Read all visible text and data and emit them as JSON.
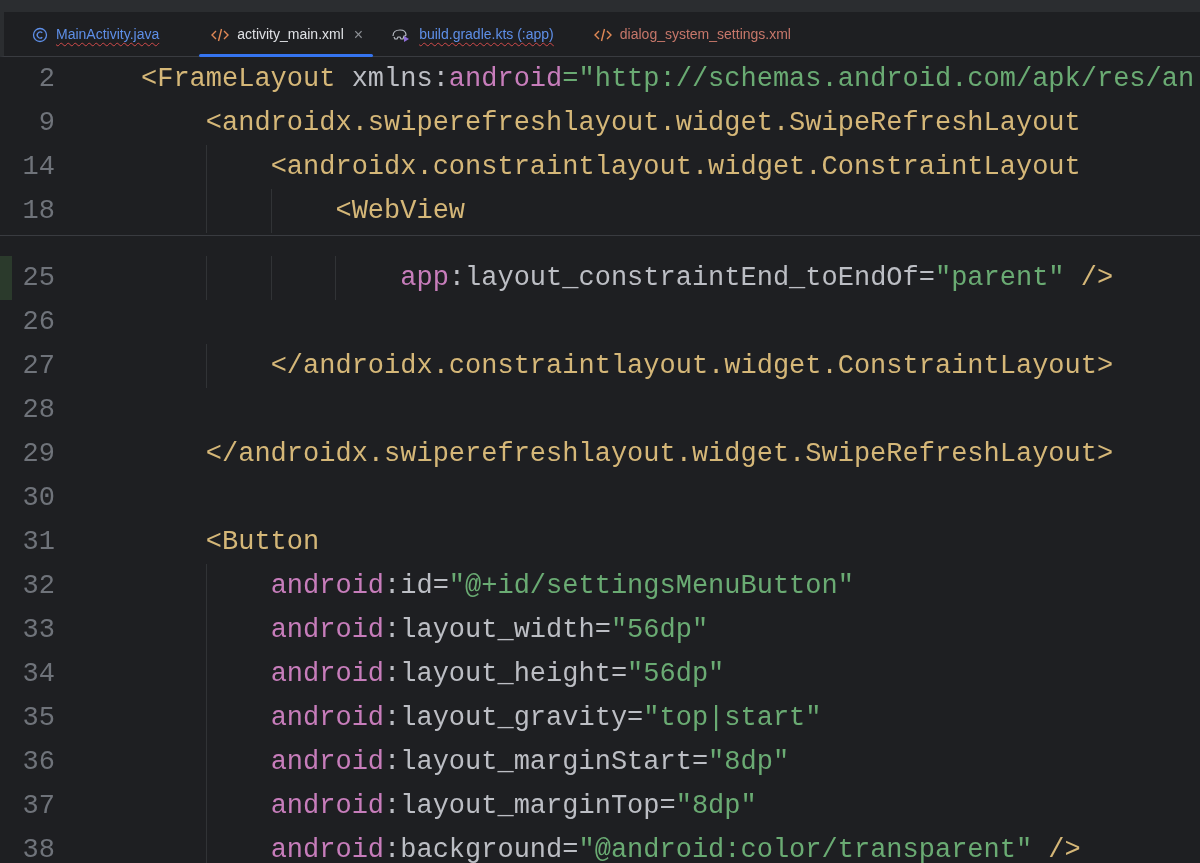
{
  "tabs": [
    {
      "label": "MainActivity.java",
      "kind": "class",
      "selected": false,
      "error": true,
      "color": "#5e8fe8"
    },
    {
      "label": "activity_main.xml",
      "kind": "xml",
      "selected": true,
      "error": false,
      "color": "#dfe1e5",
      "close": "×"
    },
    {
      "label": "build.gradle.kts (:app)",
      "kind": "gradle",
      "selected": false,
      "error": true,
      "color": "#5e8fe8"
    },
    {
      "label": "dialog_system_settings.xml",
      "kind": "xml",
      "selected": false,
      "error": false,
      "color": "#c7776a"
    }
  ],
  "sticky_lines": [
    {
      "number": "2",
      "tokens": [
        {
          "kind": "tag",
          "text": "<FrameLayout "
        },
        {
          "kind": "attr",
          "text": "xmlns:"
        },
        {
          "kind": "ns",
          "text": "android"
        },
        {
          "kind": "string",
          "text": "=\"http://schemas.android.com/apk/res/an"
        }
      ]
    },
    {
      "number": "9",
      "tokens": [
        {
          "kind": "tag",
          "text": "    <androidx.swiperefreshlayout.widget.SwipeRefreshLayout"
        }
      ]
    },
    {
      "number": "14",
      "tokens": [
        {
          "kind": "tag",
          "text": "        <androidx.constraintlayout.widget.ConstraintLayout"
        }
      ]
    },
    {
      "number": "18",
      "tokens": [
        {
          "kind": "tag",
          "text": "            <WebView"
        }
      ]
    }
  ],
  "lines": [
    {
      "number": "25",
      "modified": true,
      "tokens": [
        {
          "kind": "ns",
          "text": "                app"
        },
        {
          "kind": "attr",
          "text": ":layout_constraintEnd_toEndOf="
        },
        {
          "kind": "string",
          "text": "\"parent\""
        },
        {
          "kind": "tag",
          "text": " />"
        }
      ]
    },
    {
      "number": "26",
      "modified": false
    },
    {
      "number": "27",
      "modified": false,
      "tokens": [
        {
          "kind": "tag",
          "text": "        </androidx.constraintlayout.widget.ConstraintLayout>"
        }
      ]
    },
    {
      "number": "28",
      "modified": false
    },
    {
      "number": "29",
      "modified": false,
      "tokens": [
        {
          "kind": "tag",
          "text": "    </androidx.swiperefreshlayout.widget.SwipeRefreshLayout>"
        }
      ]
    },
    {
      "number": "30",
      "modified": false
    },
    {
      "number": "31",
      "modified": false,
      "tokens": [
        {
          "kind": "tag",
          "text": "    <Button"
        }
      ]
    },
    {
      "number": "32",
      "modified": false,
      "tokens": [
        {
          "kind": "ns",
          "text": "        android"
        },
        {
          "kind": "attr",
          "text": ":id="
        },
        {
          "kind": "string",
          "text": "\"@+id/settingsMenuButton\""
        }
      ]
    },
    {
      "number": "33",
      "modified": false,
      "tokens": [
        {
          "kind": "ns",
          "text": "        android"
        },
        {
          "kind": "attr",
          "text": ":layout_width="
        },
        {
          "kind": "string",
          "text": "\"56dp\""
        }
      ]
    },
    {
      "number": "34",
      "modified": false,
      "tokens": [
        {
          "kind": "ns",
          "text": "        android"
        },
        {
          "kind": "attr",
          "text": ":layout_height="
        },
        {
          "kind": "string",
          "text": "\"56dp\""
        }
      ]
    },
    {
      "number": "35",
      "modified": false,
      "tokens": [
        {
          "kind": "ns",
          "text": "        android"
        },
        {
          "kind": "attr",
          "text": ":layout_gravity="
        },
        {
          "kind": "string",
          "text": "\"top|start\""
        }
      ]
    },
    {
      "number": "36",
      "modified": false,
      "tokens": [
        {
          "kind": "ns",
          "text": "        android"
        },
        {
          "kind": "attr",
          "text": ":layout_marginStart="
        },
        {
          "kind": "string",
          "text": "\"8dp\""
        }
      ]
    },
    {
      "number": "37",
      "modified": false,
      "tokens": [
        {
          "kind": "ns",
          "text": "        android"
        },
        {
          "kind": "attr",
          "text": ":layout_marginTop="
        },
        {
          "kind": "string",
          "text": "\"8dp\""
        }
      ]
    },
    {
      "number": "38",
      "modified": false,
      "tokens": [
        {
          "kind": "ns",
          "text": "        android"
        },
        {
          "kind": "attr",
          "text": ":background="
        },
        {
          "kind": "string",
          "text": "\"@android:color/transparent\""
        },
        {
          "kind": "tag",
          "text": " />"
        }
      ]
    }
  ]
}
